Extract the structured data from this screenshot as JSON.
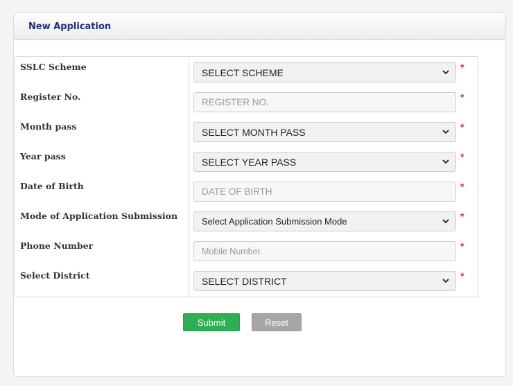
{
  "header": {
    "title": "New Application"
  },
  "form": {
    "rows": [
      {
        "label": "SSLC Scheme",
        "value": "SELECT SCHEME",
        "type": "select"
      },
      {
        "label": "Register No.",
        "value": "REGISTER NO.",
        "type": "input"
      },
      {
        "label": "Month pass",
        "value": "SELECT MONTH PASS",
        "type": "select"
      },
      {
        "label": "Year pass",
        "value": "SELECT YEAR PASS",
        "type": "select"
      },
      {
        "label": "Date of Birth",
        "value": "DATE OF BIRTH",
        "type": "input"
      },
      {
        "label": "Mode of Application Submission",
        "value": "Select Application Submission Mode",
        "type": "select"
      },
      {
        "label": "Phone Number",
        "value": "Mobile Number.",
        "type": "input"
      },
      {
        "label": "Select District",
        "value": "SELECT DISTRICT",
        "type": "select"
      }
    ],
    "required_marker": "*"
  },
  "buttons": {
    "submit": "Submit",
    "reset": "Reset"
  },
  "colors": {
    "title": "#1f2f7a",
    "required": "#e03030",
    "submit": "#2eae55",
    "reset": "#a6a6a6"
  }
}
